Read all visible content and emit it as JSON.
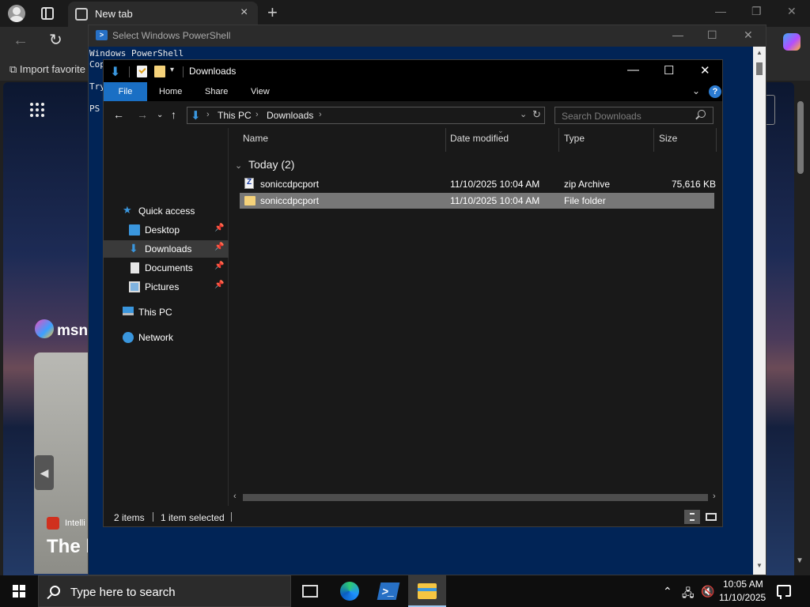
{
  "browser": {
    "tab_title": "New tab",
    "import_favorites": "Import favorite",
    "msn_text": "msn",
    "news_source": "Intelli",
    "news_headline": "The b"
  },
  "powershell": {
    "title": "Select Windows PowerShell",
    "lines": [
      "Windows PowerShell",
      "Cop",
      "",
      "Try",
      "",
      "PS"
    ]
  },
  "explorer": {
    "title": "Downloads",
    "ribbon_tabs": [
      "File",
      "Home",
      "Share",
      "View"
    ],
    "help_label": "?",
    "address": {
      "segments": [
        "This PC",
        "Downloads"
      ]
    },
    "search_placeholder": "Search Downloads",
    "nav": {
      "quick_access": "Quick access",
      "desktop": "Desktop",
      "downloads": "Downloads",
      "documents": "Documents",
      "pictures": "Pictures",
      "this_pc": "This PC",
      "network": "Network"
    },
    "columns": {
      "name": "Name",
      "date": "Date modified",
      "type": "Type",
      "size": "Size"
    },
    "group": "Today (2)",
    "files": [
      {
        "name": "soniccdpcport",
        "date": "11/10/2025 10:04 AM",
        "type": "zip Archive",
        "size": "75,616 KB",
        "icon": "zip-file-icon"
      },
      {
        "name": "soniccdpcport",
        "date": "11/10/2025 10:04 AM",
        "type": "File folder",
        "size": "",
        "icon": "folder-icon"
      }
    ],
    "status": {
      "items": "2 items",
      "selected": "1 item selected"
    }
  },
  "taskbar": {
    "search_placeholder": "Type here to search",
    "time": "10:05 AM",
    "date": "11/10/2025"
  },
  "colors": {
    "powershell_bg": "#012456",
    "ribbon_file": "#1a6fc4",
    "selection": "#777777",
    "folder": "#f5d27a"
  }
}
